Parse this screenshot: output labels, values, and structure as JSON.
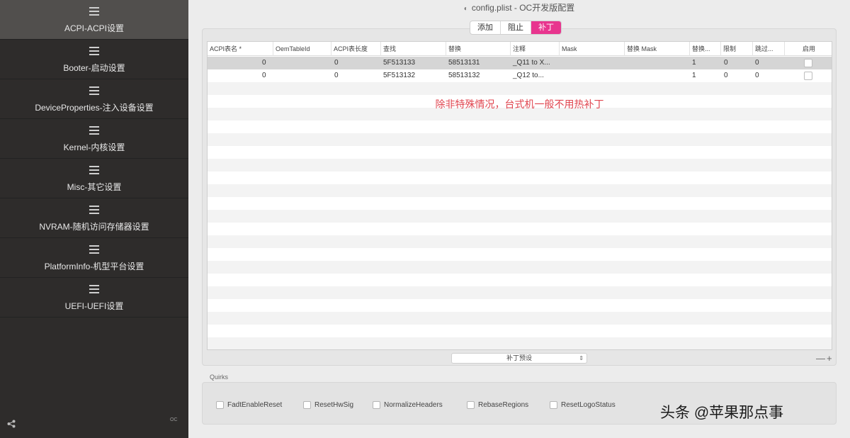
{
  "window": {
    "title": "config.plist - OC开发版配置"
  },
  "sidebar": {
    "items": [
      {
        "label": "ACPI-ACPI设置",
        "active": true
      },
      {
        "label": "Booter-启动设置"
      },
      {
        "label": "DeviceProperties-注入设备设置"
      },
      {
        "label": "Kernel-内核设置"
      },
      {
        "label": "Misc-其它设置"
      },
      {
        "label": "NVRAM-随机访问存储器设置"
      },
      {
        "label": "PlatformInfo-机型平台设置"
      },
      {
        "label": "UEFI-UEFI设置"
      }
    ],
    "bottom_text": "OC"
  },
  "tabs": [
    {
      "label": "添加"
    },
    {
      "label": "阻止"
    },
    {
      "label": "补丁",
      "active": true
    }
  ],
  "table": {
    "columns": [
      "ACPI表名 *",
      "OemTableId",
      "ACPI表长度",
      "查找",
      "替换",
      "注释",
      "Mask",
      "替换 Mask",
      "替换...",
      "限制",
      "跳过...",
      "启用"
    ],
    "rows": [
      [
        "0",
        "0",
        "5F513133",
        "58513131",
        "_Q11 to X...",
        "1",
        "0",
        "0"
      ],
      [
        "0",
        "0",
        "5F513132",
        "58513132",
        "_Q12 to...",
        "1",
        "0",
        "0"
      ]
    ],
    "note": "除非特殊情况，台式机一般不用热补丁"
  },
  "preset_select": {
    "value": "补丁预设"
  },
  "pm_buttons": "—+",
  "quirks": {
    "label": "Quirks",
    "items": [
      "FadtEnableReset",
      "ResetHwSig",
      "NormalizeHeaders",
      "RebaseRegions",
      "ResetLogoStatus"
    ]
  },
  "watermark": "头条 @苹果那点事"
}
